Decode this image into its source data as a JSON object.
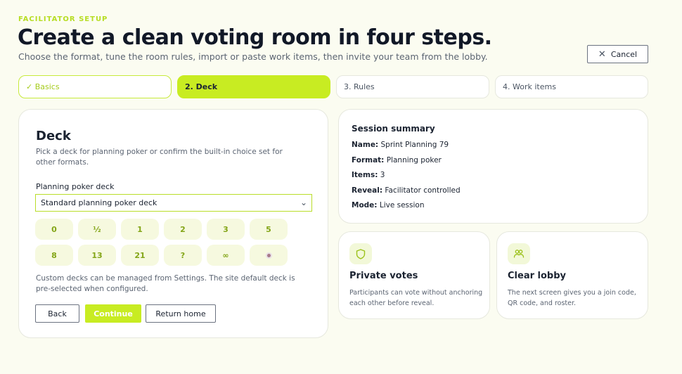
{
  "header": {
    "eyebrow": "FACILITATOR SETUP",
    "title": "Create a clean voting room in four steps.",
    "subtitle": "Choose the format, tune the room rules, import or paste work items, then invite your team from the lobby.",
    "cancel_label": "Cancel"
  },
  "steps": [
    {
      "label": "✓ Basics",
      "state": "done"
    },
    {
      "label": "2. Deck",
      "state": "active"
    },
    {
      "label": "3. Rules",
      "state": "pending"
    },
    {
      "label": "4. Work items",
      "state": "pending"
    }
  ],
  "deck": {
    "title": "Deck",
    "description": "Pick a deck for planning poker or confirm the built-in choice set for other formats.",
    "field_label": "Planning poker deck",
    "selected": "Standard planning poker deck",
    "cards": [
      "0",
      "½",
      "1",
      "2",
      "3",
      "5",
      "8",
      "13",
      "21",
      "?",
      "∞",
      "coffee-icon"
    ],
    "custom_note": "Custom decks can be managed from Settings. The site default deck is pre-selected when configured.",
    "back_label": "Back",
    "continue_label": "Continue",
    "home_label": "Return home"
  },
  "summary": {
    "title": "Session summary",
    "rows": [
      {
        "key": "Name:",
        "value": "Sprint Planning 79"
      },
      {
        "key": "Format:",
        "value": "Planning poker"
      },
      {
        "key": "Items:",
        "value": "3"
      },
      {
        "key": "Reveal:",
        "value": "Facilitator controlled"
      },
      {
        "key": "Mode:",
        "value": "Live session"
      }
    ]
  },
  "features": [
    {
      "icon": "shield-icon",
      "title": "Private votes",
      "description": "Participants can vote without anchoring each other before reveal."
    },
    {
      "icon": "users-icon",
      "title": "Clear lobby",
      "description": "The next screen gives you a join code, QR code, and roster."
    }
  ],
  "colors": {
    "accent": "#c8ec22",
    "background": "#fbfcf1",
    "card_tint": "#f6f9df"
  }
}
